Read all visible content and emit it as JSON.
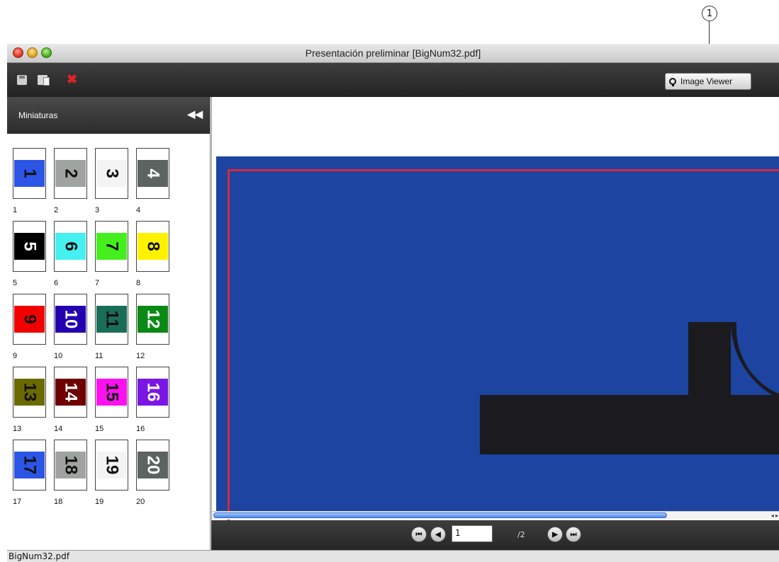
{
  "callout": {
    "number": "1"
  },
  "window": {
    "title": "Presentación preliminar [BigNum32.pdf]"
  },
  "toolbar": {
    "icons": [
      "save-icon",
      "document-icon",
      "close-icon"
    ],
    "close_glyph": "✖",
    "image_viewer_label": "Image Viewer"
  },
  "sidebar": {
    "title": "Miniaturas",
    "collapse_glyph": "◀◀",
    "thumbnails": [
      {
        "n": "1",
        "color": "#2c55e6",
        "text_color": "#111111"
      },
      {
        "n": "2",
        "color": "#a0a4a0",
        "text_color": "#111111"
      },
      {
        "n": "3",
        "color": "#f4f4f4",
        "text_color": "#111111"
      },
      {
        "n": "4",
        "color": "#5b6460",
        "text_color": "#ffffff"
      },
      {
        "n": "5",
        "color": "#000000",
        "text_color": "#ffffff"
      },
      {
        "n": "6",
        "color": "#44f0f0",
        "text_color": "#111111"
      },
      {
        "n": "7",
        "color": "#44ef1c",
        "text_color": "#111111"
      },
      {
        "n": "8",
        "color": "#fff200",
        "text_color": "#111111"
      },
      {
        "n": "9",
        "color": "#f20000",
        "text_color": "#111111"
      },
      {
        "n": "10",
        "color": "#2200b0",
        "text_color": "#ffffff"
      },
      {
        "n": "11",
        "color": "#1a6e58",
        "text_color": "#111111"
      },
      {
        "n": "12",
        "color": "#0a8a14",
        "text_color": "#ffffff"
      },
      {
        "n": "13",
        "color": "#6b6a00",
        "text_color": "#111111"
      },
      {
        "n": "14",
        "color": "#6e0000",
        "text_color": "#ffffff"
      },
      {
        "n": "15",
        "color": "#ff10f0",
        "text_color": "#111111"
      },
      {
        "n": "16",
        "color": "#7a16e6",
        "text_color": "#ffffff"
      },
      {
        "n": "17",
        "color": "#2c55e6",
        "text_color": "#111111"
      },
      {
        "n": "18",
        "color": "#a0a4a0",
        "text_color": "#111111"
      },
      {
        "n": "19",
        "color": "#f4f4f4",
        "text_color": "#111111"
      },
      {
        "n": "20",
        "color": "#5b6460",
        "text_color": "#ffffff"
      }
    ]
  },
  "preview": {
    "page_background": "#1c44a0",
    "margin_line_color": "#d8283c"
  },
  "navigation": {
    "first_glyph": "⏮",
    "prev_glyph": "◀",
    "next_glyph": "▶",
    "last_glyph": "⏭",
    "current_page": "1",
    "total_pages": "/2"
  },
  "status": {
    "filename": "BigNum32.pdf"
  }
}
